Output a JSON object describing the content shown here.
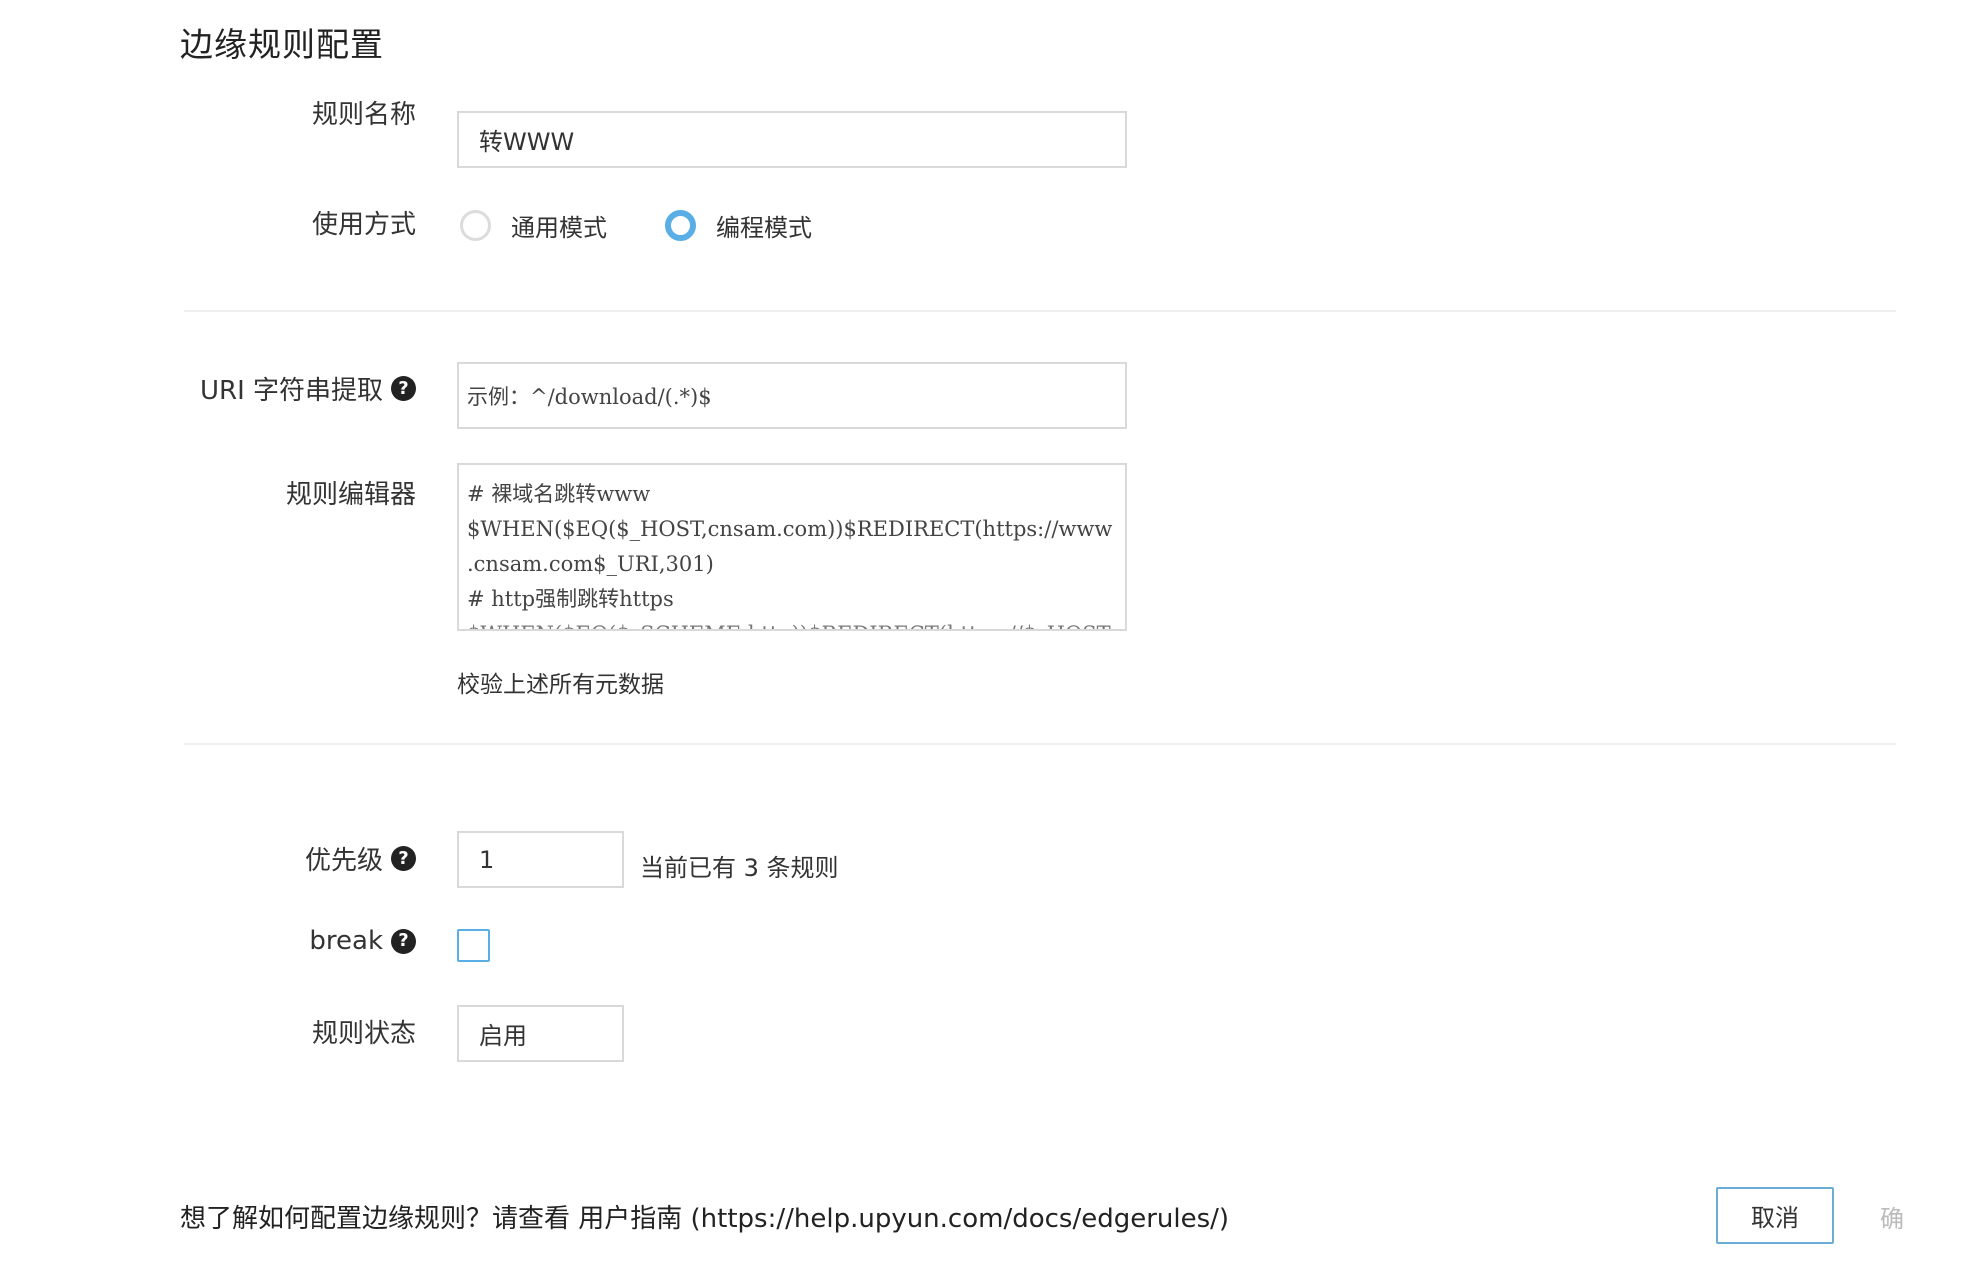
{
  "page": {
    "title": "边缘规则配置"
  },
  "form": {
    "rule_name": {
      "label": "规则名称",
      "value": "转WWW"
    },
    "usage_mode": {
      "label": "使用方式",
      "options": [
        {
          "label": "通用模式",
          "selected": false
        },
        {
          "label": "编程模式",
          "selected": true
        }
      ]
    },
    "uri_extract": {
      "label": "URI 字符串提取",
      "placeholder": "示例：^/download/(.*)$"
    },
    "rule_editor": {
      "label": "规则编辑器",
      "lines": [
        "# 裸域名跳转www",
        "$WHEN($EQ($_HOST,cnsam.com))$REDIRECT(https://www",
        ".cnsam.com$_URI,301)",
        "# http强制跳转https",
        "$WHEN($EQ($_SCHEME,http))$REDIRECT(https://$_HOST"
      ]
    },
    "validate_link": "校验上述所有元数据",
    "priority": {
      "label": "优先级",
      "value": "1",
      "hint": "当前已有 3 条规则"
    },
    "break": {
      "label": "break",
      "checked": false
    },
    "status": {
      "label": "规则状态",
      "value": "启用"
    }
  },
  "footer": {
    "help_text": "想了解如何配置边缘规则？请查看 用户指南 (https://help.upyun.com/docs/edgerules/)",
    "cancel_label": "取消",
    "confirm_label_partial": "确"
  },
  "icons": {
    "help": "question-circle-icon"
  },
  "colors": {
    "accent": "#5aaee6",
    "border": "#d9d9d9",
    "divider": "#eeeeee"
  }
}
